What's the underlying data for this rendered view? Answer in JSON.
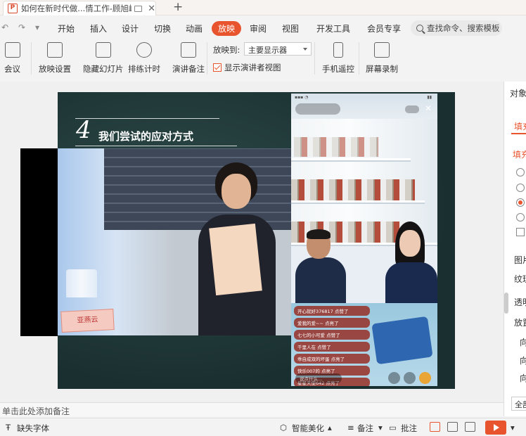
{
  "titlebar": {
    "tab_title": "如何在新时代做...情工作-顾旭峰",
    "new_tab": "+"
  },
  "menu": {
    "items": [
      "开始",
      "插入",
      "设计",
      "切换",
      "动画",
      "放映",
      "审阅",
      "视图",
      "开发工具",
      "会员专享"
    ],
    "active": "放映",
    "search_placeholder": "查找命令、搜索模板"
  },
  "toolbar": {
    "meeting": "会议",
    "slideshow_settings": "放映设置",
    "hide_slide": "隐藏幻灯片",
    "rehearse": "排练计时",
    "speaker_notes": "演讲备注",
    "play_to_label": "放映到:",
    "monitor": "主要显示器",
    "show_presenter_view": "显示演讲者视图",
    "phone_remote": "手机遥控",
    "screen_record": "屏幕录制"
  },
  "slide": {
    "number": "4",
    "title": "我们尝试的应对方式",
    "nameplate": "亚燕云",
    "live": {
      "comments": [
        "开心就好376817 点赞了",
        "爱我的爱~~ 点亮了",
        "七七的小可爱 点赞了",
        "千里人在 点赞了",
        "乖自成双的坏蛋 点亮了",
        "快乐007的 点亮了",
        "星星天使642 点亮了"
      ],
      "input_placeholder": "说点什么..."
    }
  },
  "pane": {
    "title": "对象属性",
    "tab": "填充",
    "section": "填充",
    "labels": [
      "图片",
      "纹理",
      "透明",
      "放置",
      "向",
      "向",
      "向"
    ],
    "select": "全部"
  },
  "notes_placeholder": "单击此处添加备注",
  "statusbar": {
    "missing_font": "缺失字体",
    "smart_beautify": "智能美化",
    "notes": "备注",
    "comments": "批注"
  }
}
